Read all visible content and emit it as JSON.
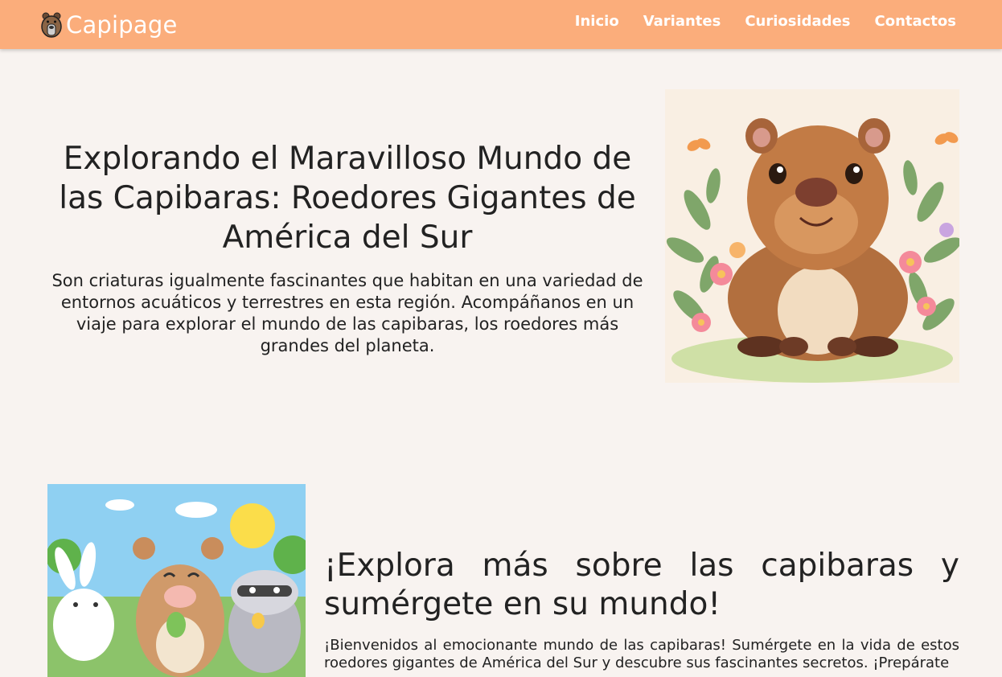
{
  "brand": {
    "name": "Capipage",
    "logo_icon": "capybara-logo-icon"
  },
  "nav": {
    "items": [
      {
        "label": "Inicio"
      },
      {
        "label": "Variantes"
      },
      {
        "label": "Curiosidades"
      },
      {
        "label": "Contactos"
      }
    ]
  },
  "hero": {
    "title": "Explorando el Maravilloso Mundo de las Capibaras: Roedores Gigantes de América del Sur",
    "description": "Son criaturas igualmente fascinantes que habitan en una variedad de entornos acuáticos y terrestres en esta región. Acompáñanos en un viaje para explorar el mundo de las capibaras, los roedores más grandes del planeta.",
    "image_icon": "capybara-illustration"
  },
  "section": {
    "title_line1": "¡Explora más sobre las capibaras y",
    "title_line2": "sumérgete en su mundo!",
    "description": "¡Bienvenidos al emocionante mundo de las capibaras! Sumérgete en la vida de estos roedores gigantes de América del Sur y descubre sus fascinantes secretos. ¡Prepárate",
    "image_icon": "capybara-friends-illustration"
  },
  "colors": {
    "navbar": "#fbad7b",
    "background": "#f8f3f0",
    "nav_text": "#ffffff"
  }
}
